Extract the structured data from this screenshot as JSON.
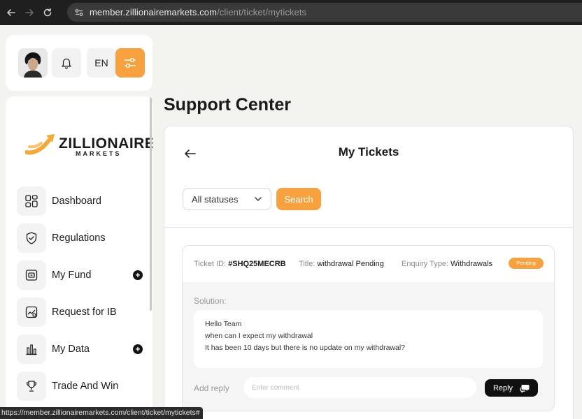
{
  "browser": {
    "url_host": "member.zillionairemarkets.com",
    "url_path": "/client/ticket/mytickets"
  },
  "topbar": {
    "language": "EN"
  },
  "brand": {
    "name": "ZILLIONAIRE",
    "sub": "MARKETS",
    "accent": "#f7a13f"
  },
  "sidebar": {
    "items": [
      {
        "label": "Dashboard",
        "icon": "grid-icon",
        "expandable": false
      },
      {
        "label": "Regulations",
        "icon": "shield-check-icon",
        "expandable": false
      },
      {
        "label": "My Fund",
        "icon": "wallet-icon",
        "expandable": true
      },
      {
        "label": "Request for IB",
        "icon": "chart-image-icon",
        "expandable": false
      },
      {
        "label": "My Data",
        "icon": "bar-chart-icon",
        "expandable": true
      },
      {
        "label": "Trade And Win",
        "icon": "trophy-icon",
        "expandable": false
      }
    ]
  },
  "page": {
    "title": "Support Center",
    "card_title": "My Tickets",
    "status_filter": "All statuses",
    "search_label": "Search"
  },
  "ticket": {
    "id_label": "Ticket ID:",
    "id_value": "#SHQ25MECRB",
    "title_label": "Title:",
    "title_value": "withdrawal Pending",
    "type_label": "Enquiry Type:",
    "type_value": "Withdrawals",
    "status": "Pending",
    "solution_label": "Solution:",
    "message_lines": [
      "Hello Team",
      "when can I expect my withdrawal",
      "It has been 10 days but there is no update on my withdrawal?"
    ],
    "reply_label": "Add reply",
    "comment_placeholder": "Enter comment",
    "reply_button": "Reply"
  },
  "statusbar": {
    "link": "https://member.zillionairemarkets.com/client/ticket/mytickets#"
  }
}
